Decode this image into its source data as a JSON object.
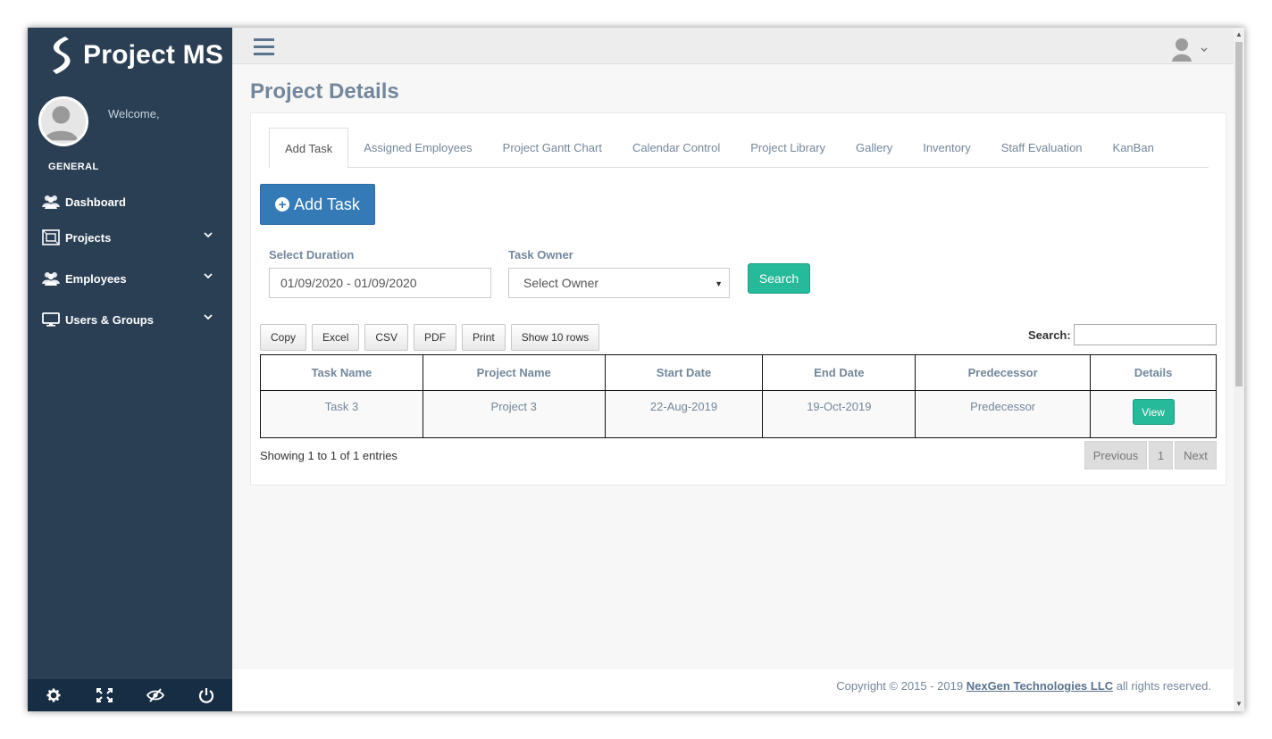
{
  "app": {
    "brand_title": "Project MS",
    "welcome_text": "Welcome,"
  },
  "sidebar": {
    "section_title": "GENERAL",
    "items": [
      {
        "label": "Dashboard",
        "icon": "users-icon",
        "has_submenu": false
      },
      {
        "label": "Projects",
        "icon": "project-board-icon",
        "has_submenu": true
      },
      {
        "label": "Employees",
        "icon": "users-icon",
        "has_submenu": true
      },
      {
        "label": "Users & Groups",
        "icon": "desktop-icon",
        "has_submenu": true
      }
    ],
    "footer_icons": [
      "gear-icon",
      "fullscreen-icon",
      "eye-slash-icon",
      "power-icon"
    ]
  },
  "page": {
    "title": "Project Details"
  },
  "tabs": [
    {
      "label": "Add Task",
      "active": true
    },
    {
      "label": "Assigned Employees",
      "active": false
    },
    {
      "label": "Project Gantt Chart",
      "active": false
    },
    {
      "label": "Calendar Control",
      "active": false
    },
    {
      "label": "Project Library",
      "active": false
    },
    {
      "label": "Gallery",
      "active": false
    },
    {
      "label": "Inventory",
      "active": false
    },
    {
      "label": "Staff Evaluation",
      "active": false
    },
    {
      "label": "KanBan",
      "active": false
    }
  ],
  "toolbar": {
    "add_task_label": "Add Task"
  },
  "filters": {
    "duration_label": "Select Duration",
    "duration_value": "01/09/2020 - 01/09/2020",
    "owner_label": "Task Owner",
    "owner_value": "Select Owner",
    "search_button": "Search"
  },
  "datatable": {
    "buttons": [
      "Copy",
      "Excel",
      "CSV",
      "PDF",
      "Print",
      "Show 10 rows"
    ],
    "search_label": "Search:",
    "search_value": "",
    "columns": [
      "Task Name",
      "Project Name",
      "Start Date",
      "End Date",
      "Predecessor",
      "Details"
    ],
    "rows": [
      {
        "task_name": "Task 3",
        "project_name": "Project 3",
        "start_date": "22-Aug-2019",
        "end_date": "19-Oct-2019",
        "predecessor": "Predecessor",
        "details_button": "View"
      }
    ],
    "info": "Showing 1 to 1 of 1 entries",
    "pagination": {
      "previous": "Previous",
      "current_page": "1",
      "next": "Next"
    }
  },
  "footer": {
    "prefix": "Copyright © 2015 - 2019 ",
    "company_link": "NexGen Technologies LLC",
    "suffix": " all rights reserved."
  },
  "colors": {
    "sidebar_bg": "#2a3f54",
    "sidebar_footer_bg": "#172d44",
    "primary": "#337ab7",
    "success": "#26b99a",
    "muted_text": "#73879c"
  }
}
